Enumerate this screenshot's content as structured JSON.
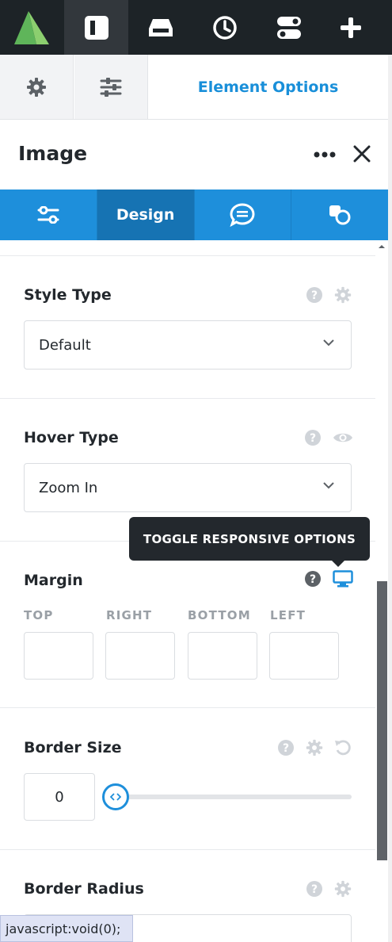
{
  "topbar": {
    "items": [
      "logo",
      "layout",
      "library",
      "history",
      "toggles",
      "add"
    ]
  },
  "subbar": {
    "settings_icon": "gear-icon",
    "sliders_icon": "sliders-icon",
    "label": "Element Options"
  },
  "element": {
    "title": "Image"
  },
  "tabs": [
    {
      "icon": "sliders-icon",
      "label": ""
    },
    {
      "icon": "",
      "label": "Design"
    },
    {
      "icon": "chat-icon",
      "label": ""
    },
    {
      "icon": "shapes-icon",
      "label": ""
    }
  ],
  "options": {
    "style_type": {
      "label": "Style Type",
      "value": "Default"
    },
    "hover_type": {
      "label": "Hover Type",
      "value": "Zoom In"
    },
    "margin": {
      "label": "Margin",
      "fields": [
        "TOP",
        "RIGHT",
        "BOTTOM",
        "LEFT"
      ],
      "values": [
        "",
        "",
        "",
        ""
      ]
    },
    "border_size": {
      "label": "Border Size",
      "value": "0"
    },
    "border_radius": {
      "label": "Border Radius"
    }
  },
  "tooltip": {
    "text": "TOGGLE RESPONSIVE OPTIONS"
  },
  "status_bar": {
    "text": "javascript:void(0);"
  },
  "colors": {
    "accent": "#1e8fdb",
    "dark": "#1d2327",
    "label": "#23282d",
    "muted": "#9aa0a6"
  }
}
